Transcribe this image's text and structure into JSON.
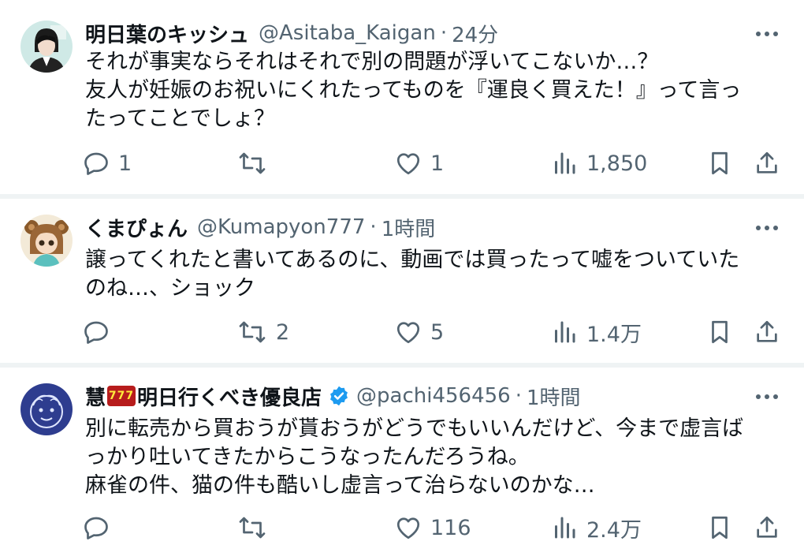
{
  "tweets": [
    {
      "name": "明日葉のキッシュ",
      "handle": "@Asitaba_Kaigan",
      "dot": "·",
      "time": "24分",
      "verified": false,
      "lines": [
        "それが事実ならそれはそれで別の問題が浮いてこないか…？",
        "友人が妊娠のお祝いにくれたってものを『運良く買えた！』って言っ",
        "たってことでしょ？"
      ],
      "replies": "1",
      "retweets": "",
      "likes": "1",
      "views": "1,850"
    },
    {
      "name": "くまぴょん",
      "handle": "@Kumapyon777",
      "dot": "·",
      "time": "1時間",
      "verified": false,
      "lines": [
        "譲ってくれたと書いてあるのに、動画では買ったって嘘をついていた",
        "のね…、ショック"
      ],
      "replies": "",
      "retweets": "2",
      "likes": "5",
      "views": "1.4万"
    },
    {
      "name_prefix": "慧",
      "name_badge": "777",
      "name": "明日行くべき優良店",
      "handle": "@pachi456456",
      "dot": "·",
      "time": "1時間",
      "verified": true,
      "lines": [
        "別に転売から買おうが貰おうがどうでもいいんだけど、今まで虚言ば",
        "っかり吐いてきたからこうなったんだろうね。",
        "麻雀の件、猫の件も酷いし虚言って治らないのかな…"
      ],
      "replies": "",
      "retweets": "",
      "likes": "116",
      "views": "2.4万"
    }
  ],
  "colors": {
    "text": "#0f1419",
    "secondary": "#536471",
    "separator": "#eff3f4",
    "verified": "#1d9bf0"
  },
  "icons": [
    "reply-icon",
    "retweet-icon",
    "like-icon",
    "views-icon",
    "bookmark-icon",
    "share-icon",
    "more-icon",
    "verified-icon"
  ]
}
